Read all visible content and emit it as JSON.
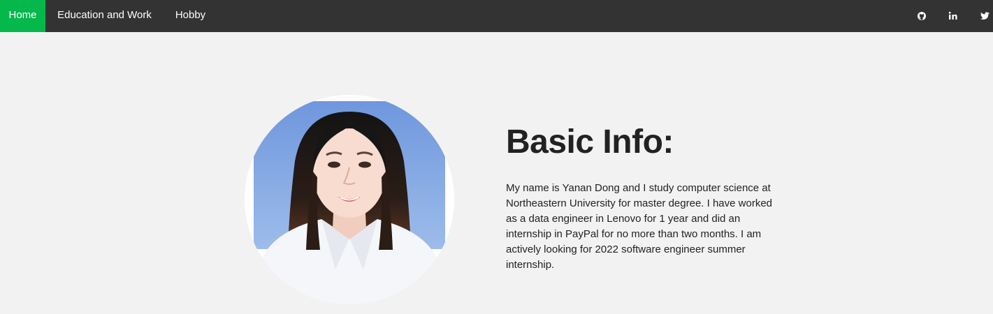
{
  "nav": {
    "items": [
      {
        "label": "Home",
        "active": true
      },
      {
        "label": "Education and Work"
      },
      {
        "label": "Hobby"
      }
    ],
    "social_icons": [
      "github-icon",
      "linkedin-icon",
      "twitter-icon"
    ]
  },
  "main": {
    "heading": "Basic Info:",
    "bio": "My name is Yanan Dong and I study computer science at Northeastern University for master degree. I have worked as a data engineer in Lenovo for 1 year and did an internship in PayPal for no more than two months. I am actively looking for 2022 software engineer summer internship."
  },
  "colors": {
    "nav_bg": "#333333",
    "nav_active": "#04b84c",
    "page_bg": "#f2f2f2",
    "text": "#222222"
  }
}
